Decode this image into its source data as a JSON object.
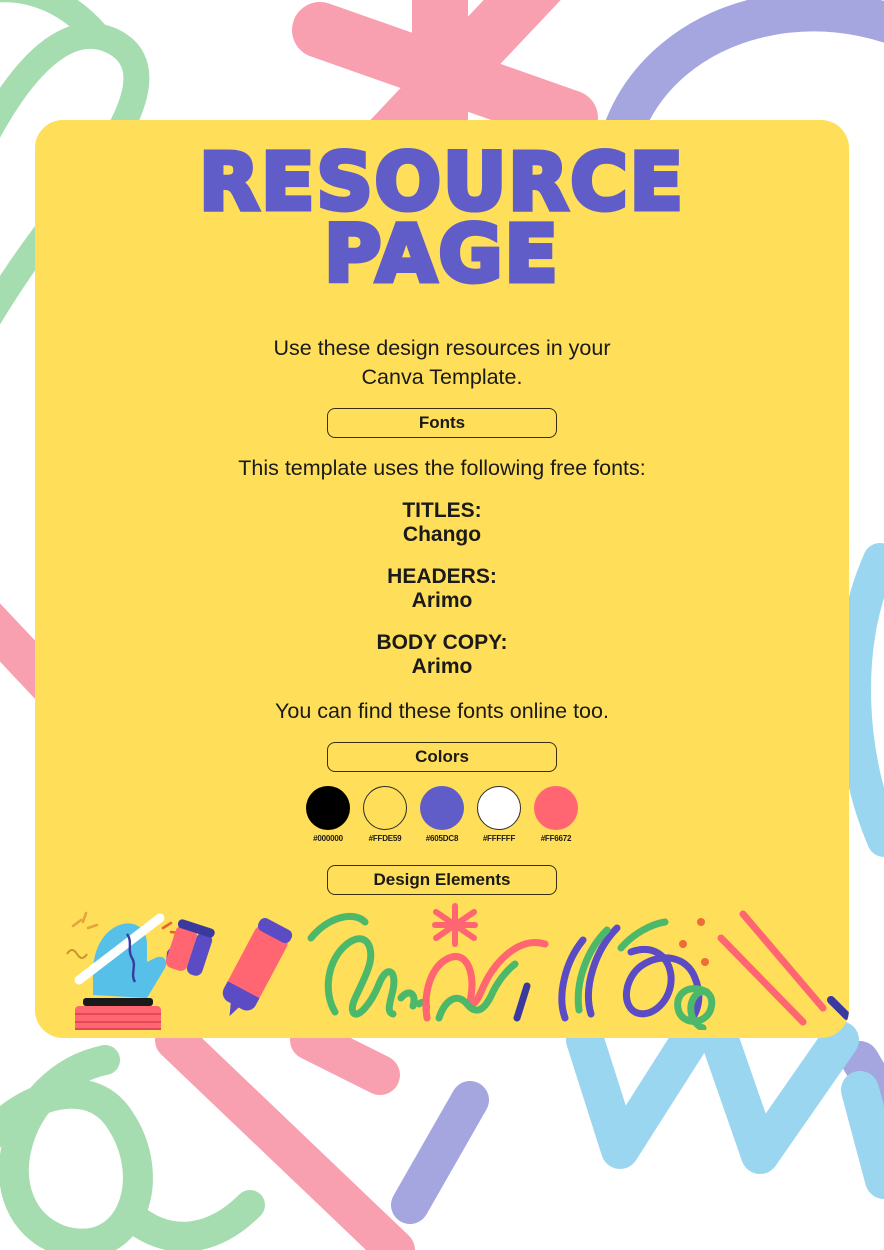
{
  "page": {
    "background_color": "#FFFFFF",
    "card_color": "#FFDE59",
    "accent_color": "#605DC8"
  },
  "title": {
    "line1": "RESOURCE",
    "line2": "PAGE"
  },
  "intro": {
    "line1": "Use these design resources in your",
    "line2": "Canva Template."
  },
  "sections": {
    "fonts_button": "Fonts",
    "colors_button": "Colors",
    "design_elements_button": "Design Elements"
  },
  "fonts": {
    "lead": "This template uses the following free fonts:",
    "groups": [
      {
        "label": "TITLES:",
        "value": "Chango"
      },
      {
        "label": "HEADERS:",
        "value": "Arimo"
      },
      {
        "label": "BODY COPY:",
        "value": "Arimo"
      }
    ],
    "footer": "You can find these fonts online too."
  },
  "colors": {
    "swatches": [
      {
        "hex": "#000000",
        "label": "#000000"
      },
      {
        "hex": "#FFDE59",
        "label": "#FFDE59"
      },
      {
        "hex": "#605DC8",
        "label": "#605DC8"
      },
      {
        "hex": "#FFFFFF",
        "label": "#FFFFFF"
      },
      {
        "hex": "#FF6672",
        "label": "#FF6672"
      }
    ]
  },
  "design_elements": [
    {
      "name": "hand-holding-pen-illustration"
    },
    {
      "name": "highlighter-markers-illustration"
    },
    {
      "name": "green-scribble-doodle"
    },
    {
      "name": "pink-star-doodle"
    },
    {
      "name": "purple-loops-doodle"
    },
    {
      "name": "pink-lines-doodle"
    }
  ],
  "background_decor": [
    {
      "name": "green-swirl-top-left",
      "color": "#A5DCB0"
    },
    {
      "name": "pink-star-top-center",
      "color": "#F9A0B0"
    },
    {
      "name": "purple-arc-top-right",
      "color": "#A5A5E0"
    },
    {
      "name": "pink-diagonal-left",
      "color": "#F9A0B0"
    },
    {
      "name": "green-loop-bottom-left",
      "color": "#A5DCB0"
    },
    {
      "name": "blue-zigzag-bottom-right",
      "color": "#9BD6F0"
    },
    {
      "name": "purple-dash-bottom-center",
      "color": "#A5A5E0"
    }
  ]
}
